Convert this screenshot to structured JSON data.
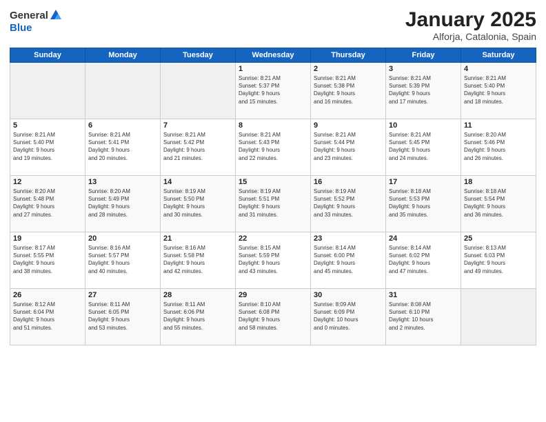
{
  "header": {
    "logo_general": "General",
    "logo_blue": "Blue",
    "title": "January 2025",
    "subtitle": "Alforja, Catalonia, Spain"
  },
  "weekdays": [
    "Sunday",
    "Monday",
    "Tuesday",
    "Wednesday",
    "Thursday",
    "Friday",
    "Saturday"
  ],
  "weeks": [
    [
      {
        "day": "",
        "info": ""
      },
      {
        "day": "",
        "info": ""
      },
      {
        "day": "",
        "info": ""
      },
      {
        "day": "1",
        "info": "Sunrise: 8:21 AM\nSunset: 5:37 PM\nDaylight: 9 hours\nand 15 minutes."
      },
      {
        "day": "2",
        "info": "Sunrise: 8:21 AM\nSunset: 5:38 PM\nDaylight: 9 hours\nand 16 minutes."
      },
      {
        "day": "3",
        "info": "Sunrise: 8:21 AM\nSunset: 5:39 PM\nDaylight: 9 hours\nand 17 minutes."
      },
      {
        "day": "4",
        "info": "Sunrise: 8:21 AM\nSunset: 5:40 PM\nDaylight: 9 hours\nand 18 minutes."
      }
    ],
    [
      {
        "day": "5",
        "info": "Sunrise: 8:21 AM\nSunset: 5:40 PM\nDaylight: 9 hours\nand 19 minutes."
      },
      {
        "day": "6",
        "info": "Sunrise: 8:21 AM\nSunset: 5:41 PM\nDaylight: 9 hours\nand 20 minutes."
      },
      {
        "day": "7",
        "info": "Sunrise: 8:21 AM\nSunset: 5:42 PM\nDaylight: 9 hours\nand 21 minutes."
      },
      {
        "day": "8",
        "info": "Sunrise: 8:21 AM\nSunset: 5:43 PM\nDaylight: 9 hours\nand 22 minutes."
      },
      {
        "day": "9",
        "info": "Sunrise: 8:21 AM\nSunset: 5:44 PM\nDaylight: 9 hours\nand 23 minutes."
      },
      {
        "day": "10",
        "info": "Sunrise: 8:21 AM\nSunset: 5:45 PM\nDaylight: 9 hours\nand 24 minutes."
      },
      {
        "day": "11",
        "info": "Sunrise: 8:20 AM\nSunset: 5:46 PM\nDaylight: 9 hours\nand 26 minutes."
      }
    ],
    [
      {
        "day": "12",
        "info": "Sunrise: 8:20 AM\nSunset: 5:48 PM\nDaylight: 9 hours\nand 27 minutes."
      },
      {
        "day": "13",
        "info": "Sunrise: 8:20 AM\nSunset: 5:49 PM\nDaylight: 9 hours\nand 28 minutes."
      },
      {
        "day": "14",
        "info": "Sunrise: 8:19 AM\nSunset: 5:50 PM\nDaylight: 9 hours\nand 30 minutes."
      },
      {
        "day": "15",
        "info": "Sunrise: 8:19 AM\nSunset: 5:51 PM\nDaylight: 9 hours\nand 31 minutes."
      },
      {
        "day": "16",
        "info": "Sunrise: 8:19 AM\nSunset: 5:52 PM\nDaylight: 9 hours\nand 33 minutes."
      },
      {
        "day": "17",
        "info": "Sunrise: 8:18 AM\nSunset: 5:53 PM\nDaylight: 9 hours\nand 35 minutes."
      },
      {
        "day": "18",
        "info": "Sunrise: 8:18 AM\nSunset: 5:54 PM\nDaylight: 9 hours\nand 36 minutes."
      }
    ],
    [
      {
        "day": "19",
        "info": "Sunrise: 8:17 AM\nSunset: 5:55 PM\nDaylight: 9 hours\nand 38 minutes."
      },
      {
        "day": "20",
        "info": "Sunrise: 8:16 AM\nSunset: 5:57 PM\nDaylight: 9 hours\nand 40 minutes."
      },
      {
        "day": "21",
        "info": "Sunrise: 8:16 AM\nSunset: 5:58 PM\nDaylight: 9 hours\nand 42 minutes."
      },
      {
        "day": "22",
        "info": "Sunrise: 8:15 AM\nSunset: 5:59 PM\nDaylight: 9 hours\nand 43 minutes."
      },
      {
        "day": "23",
        "info": "Sunrise: 8:14 AM\nSunset: 6:00 PM\nDaylight: 9 hours\nand 45 minutes."
      },
      {
        "day": "24",
        "info": "Sunrise: 8:14 AM\nSunset: 6:02 PM\nDaylight: 9 hours\nand 47 minutes."
      },
      {
        "day": "25",
        "info": "Sunrise: 8:13 AM\nSunset: 6:03 PM\nDaylight: 9 hours\nand 49 minutes."
      }
    ],
    [
      {
        "day": "26",
        "info": "Sunrise: 8:12 AM\nSunset: 6:04 PM\nDaylight: 9 hours\nand 51 minutes."
      },
      {
        "day": "27",
        "info": "Sunrise: 8:11 AM\nSunset: 6:05 PM\nDaylight: 9 hours\nand 53 minutes."
      },
      {
        "day": "28",
        "info": "Sunrise: 8:11 AM\nSunset: 6:06 PM\nDaylight: 9 hours\nand 55 minutes."
      },
      {
        "day": "29",
        "info": "Sunrise: 8:10 AM\nSunset: 6:08 PM\nDaylight: 9 hours\nand 58 minutes."
      },
      {
        "day": "30",
        "info": "Sunrise: 8:09 AM\nSunset: 6:09 PM\nDaylight: 10 hours\nand 0 minutes."
      },
      {
        "day": "31",
        "info": "Sunrise: 8:08 AM\nSunset: 6:10 PM\nDaylight: 10 hours\nand 2 minutes."
      },
      {
        "day": "",
        "info": ""
      }
    ]
  ]
}
